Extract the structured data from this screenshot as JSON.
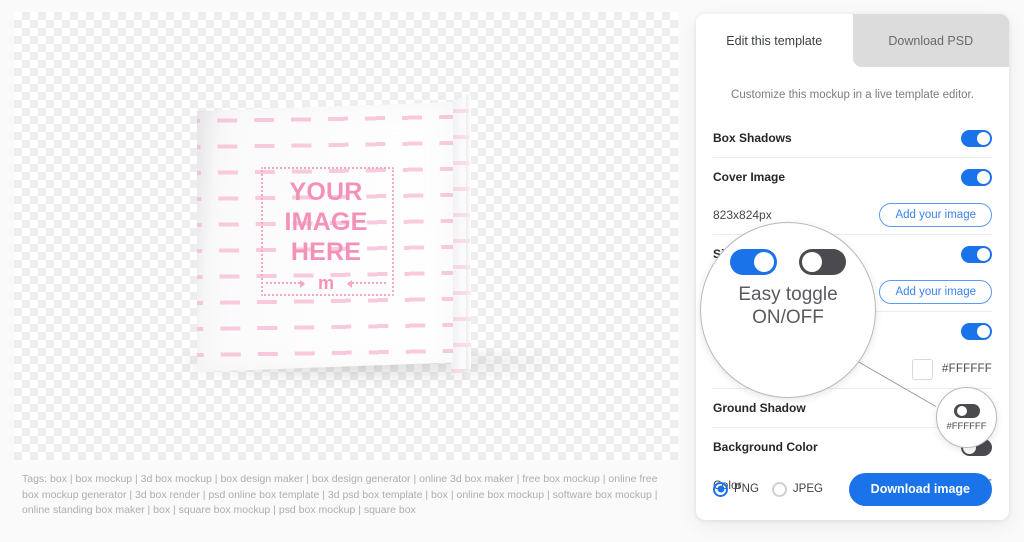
{
  "canvas": {
    "mockup": {
      "placeholder_text": "YOUR\nIMAGE\nHERE",
      "placeholder_line1": "YOUR",
      "placeholder_line2": "IMAGE",
      "placeholder_line3": "HERE",
      "logo_glyph": "m",
      "accent_color": "#F491B9"
    },
    "tags_text": "Tags: box | box mockup | 3d box mockup | box design maker | box design generator | online 3d box maker | free box mockup | online free box mockup generator | 3d box render | psd online box template | 3d psd box template | box | online box mockup | software box mockup | online standing box maker | box | square box mockup | psd box mockup | square box"
  },
  "panel": {
    "tabs": [
      {
        "label": "Edit this template",
        "active": true
      },
      {
        "label": "Download PSD",
        "active": false
      }
    ],
    "subtitle": "Customize this mockup in a live template editor.",
    "rows": [
      {
        "label": "Box Shadows",
        "toggle": "on"
      },
      {
        "label": "Cover Image",
        "toggle": "on"
      },
      {
        "label": "823x824px",
        "button": "Add your image"
      },
      {
        "label": "Side Image",
        "toggle": "on"
      },
      {
        "label": "",
        "button": "Add your image"
      },
      {
        "label": "",
        "toggle": "on"
      },
      {
        "label": "",
        "hex": "#FFFFFF"
      },
      {
        "label": "Ground Shadow",
        "toggle": "on"
      },
      {
        "label": "Background Color",
        "toggle": "off"
      },
      {
        "label": "Color",
        "hex": "#FFFFFF"
      }
    ],
    "footer": {
      "formats": [
        {
          "label": "PNG",
          "selected": true
        },
        {
          "label": "JPEG",
          "selected": false
        }
      ],
      "download_label": "Download image"
    },
    "accent_color": "#1A73E8"
  },
  "callouts": {
    "big": {
      "caption_line1": "Easy toggle",
      "caption_line2": "ON/OFF",
      "toggle_on": "on",
      "toggle_off": "off"
    },
    "small": {
      "toggle": "off",
      "hex": "#FFFFFF"
    }
  }
}
